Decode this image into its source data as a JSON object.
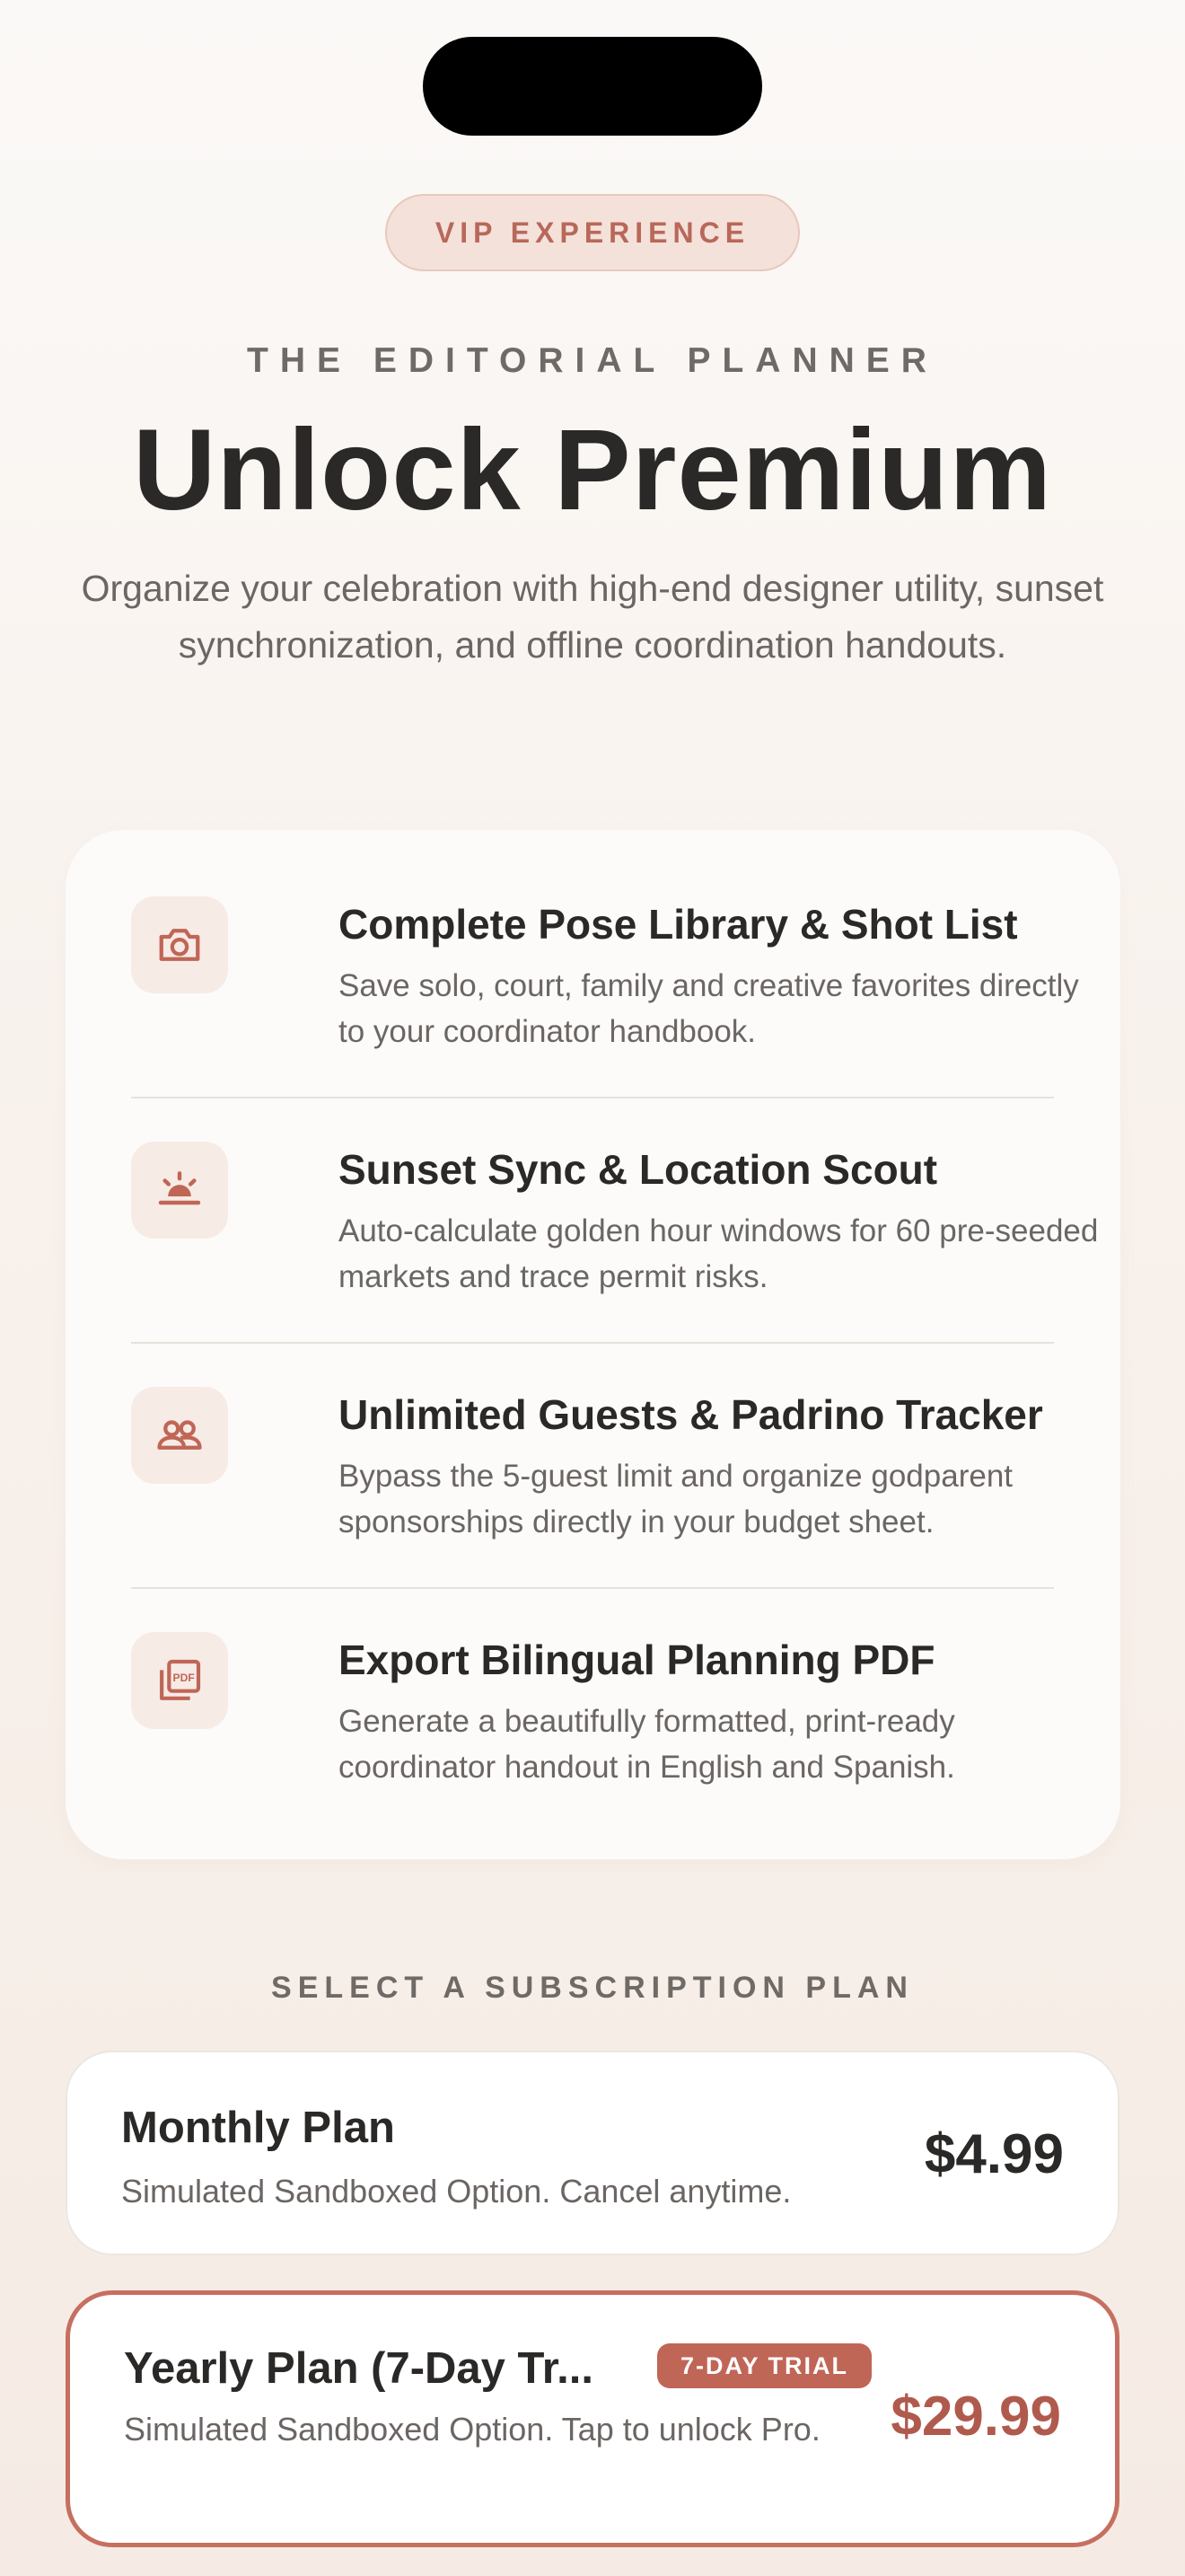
{
  "header": {
    "badge": "VIP EXPERIENCE",
    "eyebrow": "THE EDITORIAL PLANNER",
    "title": "Unlock Premium",
    "subtitle": "Organize your celebration with high-end designer utility, sunset synchronization, and offline coordination handouts."
  },
  "features": [
    {
      "icon": "camera-icon",
      "title": "Complete Pose Library & Shot List",
      "description": "Save solo, court, family and creative favorites directly to your coordinator handbook."
    },
    {
      "icon": "sunset-icon",
      "title": "Sunset Sync & Location Scout",
      "description": "Auto-calculate golden hour windows for 60 pre-seeded markets and trace permit risks."
    },
    {
      "icon": "users-icon",
      "title": "Unlimited Guests & Padrino Tracker",
      "description": "Bypass the 5-guest limit and organize godparent sponsorships directly in your budget sheet."
    },
    {
      "icon": "pdf-icon",
      "title": "Export Bilingual Planning PDF",
      "description": "Generate a beautifully formatted, print-ready coordinator handout in English and Spanish."
    }
  ],
  "plans_label": "SELECT A SUBSCRIPTION PLAN",
  "plans": {
    "monthly": {
      "name": "Monthly Plan",
      "description": "Simulated Sandboxed Option. Cancel anytime.",
      "price": "$4.99"
    },
    "yearly": {
      "name": "Yearly Plan (7-Day Tr...",
      "badge": "7-DAY TRIAL",
      "description": "Simulated Sandboxed Option. Tap to unlock Pro.",
      "price": "$29.99",
      "selected": true
    }
  },
  "colors": {
    "accent": "#c06656",
    "text": "#2b2927",
    "muted": "#6b6663",
    "icon_bg": "#f7ebe6"
  }
}
